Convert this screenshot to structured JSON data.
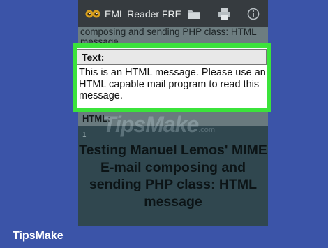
{
  "app": {
    "title": "EML Reader FRE",
    "icons": [
      "app-owl-icon",
      "folder-icon",
      "printer-icon",
      "info-icon"
    ]
  },
  "message": {
    "subject_partial": "composing and sending PHP class: HTML message",
    "text_label": "Text:",
    "text_body": "This is an HTML message. Please use an HTML capable mail program to read this message.",
    "html_label": "HTML:",
    "page_number": "1",
    "html_heading": "Testing Manuel Lemos' MIME E-mail composing and sending PHP class: HTML message"
  },
  "overlay": {
    "watermark": "TipsMake",
    "watermark_suffix": ".com",
    "highlight_color": "#3be33b"
  },
  "footer": {
    "brand": "TipsMake"
  },
  "colors": {
    "background": "#3b54a8",
    "toolbar": "#363b3f",
    "highlight": "#3be33b"
  }
}
